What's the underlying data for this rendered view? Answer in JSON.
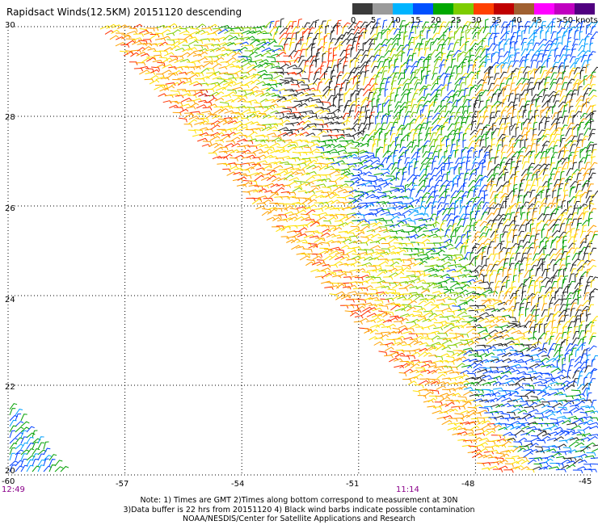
{
  "title": "Rapidsact Winds(12.5KM) 20151120 descending",
  "colorbar": {
    "units": "knots",
    "labels": [
      "0",
      "5",
      "10",
      "15",
      "20",
      "25",
      "30",
      "35",
      "40",
      "45",
      ">50 knots"
    ],
    "colors": [
      "#3a3a3a",
      "#9a9a9a",
      "#00b4ff",
      "#0050ff",
      "#00a800",
      "#7ccc00",
      "#ffe000",
      "#ffa000",
      "#ff4000",
      "#c00000",
      "#a06030",
      "#ff00ff",
      "#c000c0",
      "#500080"
    ]
  },
  "axes": {
    "lat_labels": [
      "30",
      "28",
      "26",
      "24",
      "22",
      "20"
    ],
    "lon_labels": [
      "-60",
      "-57",
      "-54",
      "-51",
      "-48",
      "-45"
    ]
  },
  "time_labels": {
    "left": "12:49",
    "center": "11:14"
  },
  "notes": {
    "line1": "Note: 1) Times are GMT 2)Times along bottom correspond to measurement at 30N",
    "line2": "3)Data buffer is 22 hrs from 20151120 4) Black wind barbs indicate possible contamination",
    "line3": "NOAA/NESDIS/Center for Satellite Applications and Research"
  }
}
